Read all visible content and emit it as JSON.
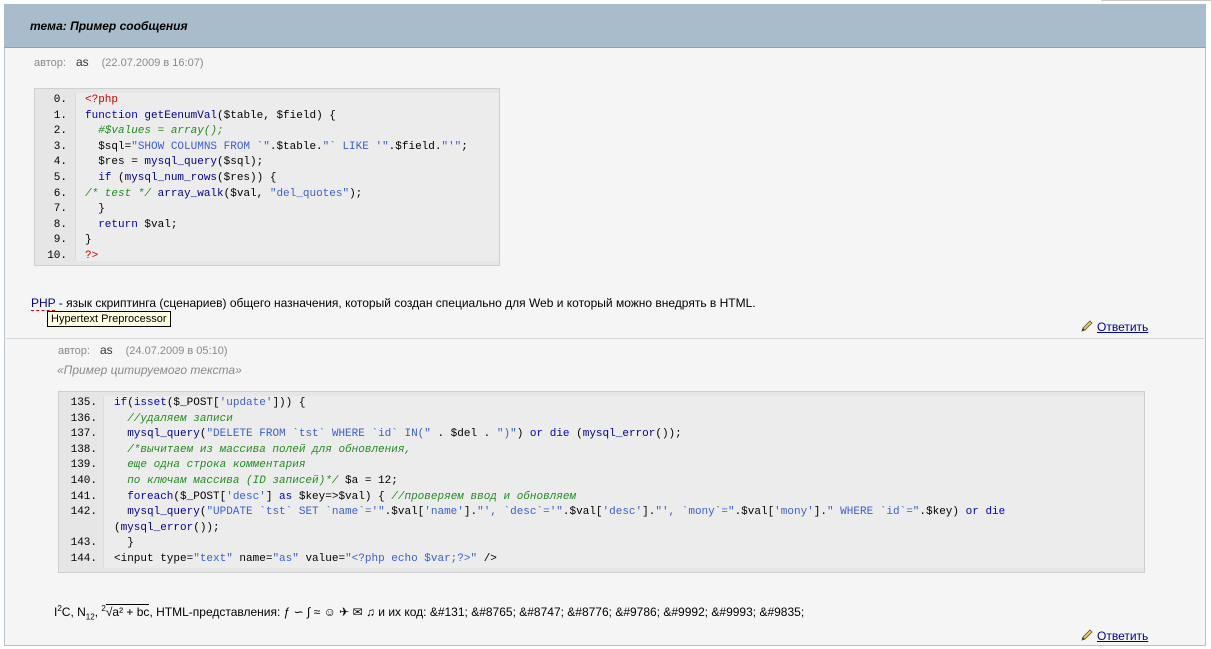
{
  "topic": {
    "label": "тема: Пример сообщения"
  },
  "posts": [
    {
      "author_label": "автор:",
      "author": "as",
      "date": "(22.07.2009 в 16:07)",
      "code": {
        "numbers": [
          "0.",
          "1.",
          "2.",
          "3.",
          "4.",
          "5.",
          "6.",
          "7.",
          "8.",
          "9.",
          "10."
        ],
        "lines": [
          "<?php",
          "function getEenumVal($table, $field) {",
          "  #$values = array();",
          "  $sql=\"SHOW COLUMNS FROM `\".$table.\"` LIKE '\".$field.\"'\";",
          "  $res = mysql_query($sql);",
          "  if (mysql_num_rows($res)) {",
          "/* test */ array_walk($val, \"del_quotes\");",
          "  }",
          "  return $val;",
          "}",
          "?>"
        ]
      },
      "description_abbr": "PHP",
      "description_rest": " - язык скриптинга (сценариев) общего назначения, который создан специально для Web и который можно внедрять в HTML.",
      "tooltip": "Hypertext Preprocessor",
      "reply": "Ответить"
    },
    {
      "author_label": "автор:",
      "author": "as",
      "date": "(24.07.2009 в 05:10)",
      "quote": "«Пример цитируемого текста»",
      "code": {
        "numbers": [
          "135.",
          "136.",
          "137.",
          "138.",
          "139.",
          "140.",
          "141.",
          "142.",
          "",
          "143.",
          "144."
        ],
        "lines": [
          "if(isset($_POST['update'])) {",
          "  //удаляем записи",
          "  mysql_query(\"DELETE FROM `tst` WHERE `id` IN(\" . $del . \")\") or die (mysql_error());",
          "  /*вычитаем из массива полей для обновления,",
          "  еще одна строка комментария",
          "  по ключам массива (ID записей)*/ $a = 12;",
          "  foreach($_POST['desc'] as $key=>$val) { //проверяем ввод и обновляем",
          "  mysql_query(\"UPDATE `tst` SET `name`='\".$val['name'].\"', `desc`='\".$val['desc'].\"', `mony`=\".$val['mony'].\" WHERE `id`=\".$key) or die",
          "(mysql_error());",
          "  }",
          "<input type=\"text\" name=\"as\" value=\"<?php echo $var;?>\" />"
        ]
      },
      "special": {
        "part1": "I",
        "sup1": "2",
        "part2": "C, N",
        "sub1": "12",
        "part3": ", ",
        "sup2": "2",
        "radical": "√a² + bc",
        "part4": ", HTML-представления: ƒ ∽ ∫ ≈ ☺ ✈ ✉ ♫ и их код: &#131; &#8765; &#8747; &#8776; &#9786; &#9992; &#9993; &#9835;"
      },
      "reply": "Ответить"
    }
  ]
}
